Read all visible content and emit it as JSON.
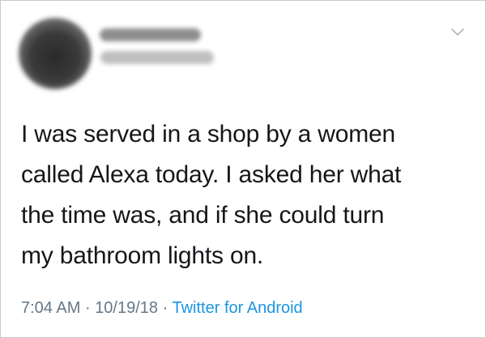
{
  "tweet": {
    "author_display_name": "",
    "author_handle": "",
    "text_lines": [
      "I was served in a shop by a women",
      "called Alexa today. I asked her what",
      "the time was, and if she could turn",
      "my bathroom lights on."
    ],
    "time": "7:04 AM",
    "separator": "·",
    "date": "10/19/18",
    "source": "Twitter for Android"
  },
  "icons": {
    "menu": "chevron-down-icon"
  },
  "colors": {
    "text": "#14171a",
    "meta": "#657786",
    "link": "#1b95e0",
    "border": "#c9c9c9"
  }
}
